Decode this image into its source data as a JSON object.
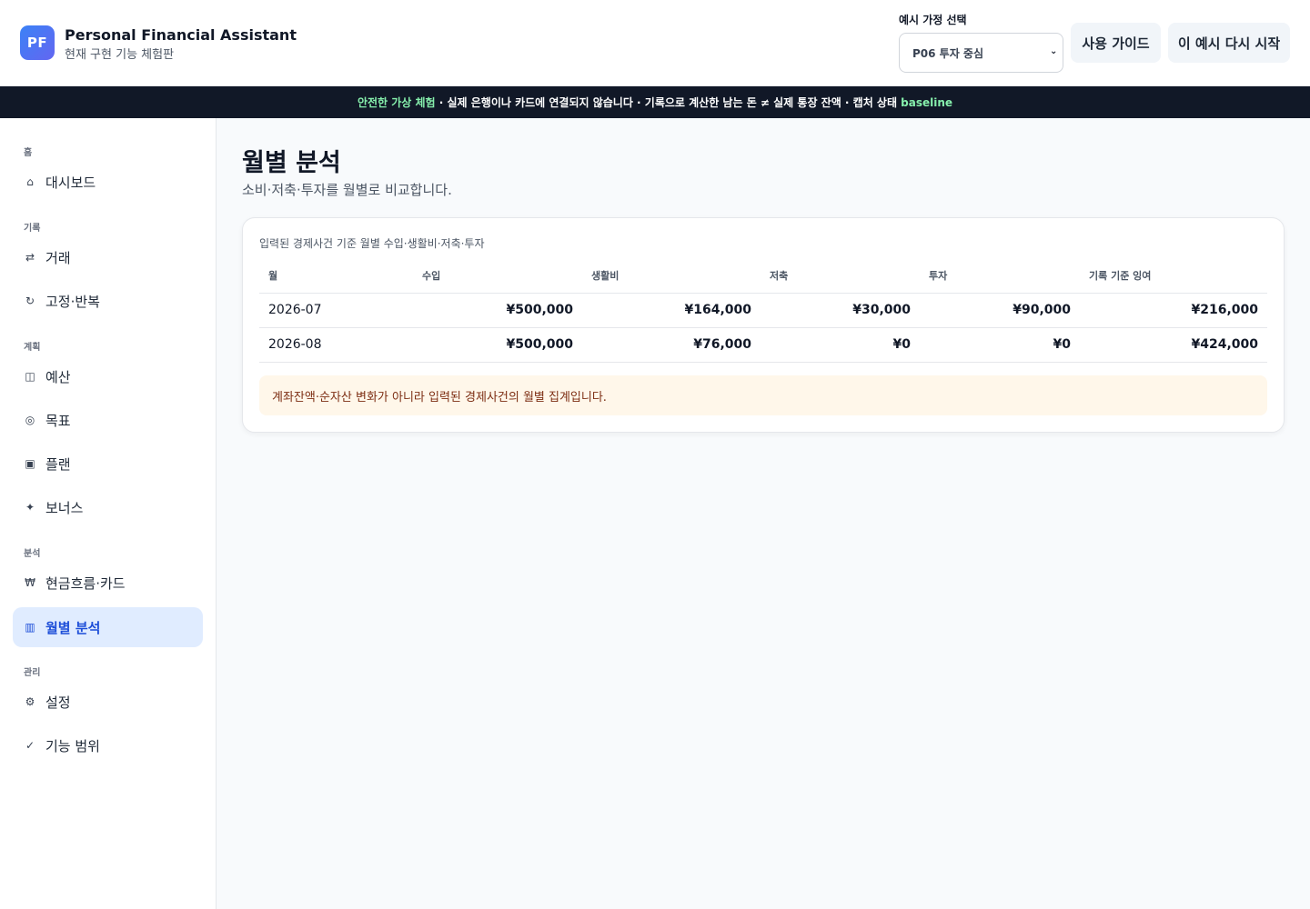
{
  "header": {
    "logo_text": "PF",
    "title": "Personal Financial Assistant",
    "subtitle": "현재 구현 기능 체험판",
    "select_label": "예시 가정 선택",
    "select_value": "P06 투자 중심",
    "guide_button": "사용 가이드",
    "restart_button": "이 예시 다시 시작"
  },
  "banner": {
    "highlight": "안전한 가상 체험",
    "text": " · 실제 은행이나 카드에 연결되지 않습니다 · 기록으로 계산한 남는 돈 ≠ 실제 통장 잔액 · 캡처 상태 ",
    "status": "baseline"
  },
  "sidebar": {
    "sections": [
      {
        "label": "홈",
        "items": [
          {
            "icon": "home-icon",
            "glyph": "⌂",
            "label": "대시보드"
          }
        ]
      },
      {
        "label": "기록",
        "items": [
          {
            "icon": "swap-icon",
            "glyph": "⇄",
            "label": "거래"
          },
          {
            "icon": "repeat-icon",
            "glyph": "↻",
            "label": "고정·반복"
          }
        ]
      },
      {
        "label": "계획",
        "items": [
          {
            "icon": "budget-icon",
            "glyph": "◫",
            "label": "예산"
          },
          {
            "icon": "target-icon",
            "glyph": "◎",
            "label": "목표"
          },
          {
            "icon": "plan-icon",
            "glyph": "▣",
            "label": "플랜"
          },
          {
            "icon": "sparkle-icon",
            "glyph": "✦",
            "label": "보너스"
          }
        ]
      },
      {
        "label": "분석",
        "items": [
          {
            "icon": "won-icon",
            "glyph": "₩",
            "label": "현금흐름·카드"
          },
          {
            "icon": "bar-chart-icon",
            "glyph": "▥",
            "label": "월별 분석",
            "active": true
          }
        ]
      },
      {
        "label": "관리",
        "items": [
          {
            "icon": "gear-icon",
            "glyph": "⚙",
            "label": "설정"
          },
          {
            "icon": "check-icon",
            "glyph": "✓",
            "label": "기능 범위"
          }
        ]
      }
    ]
  },
  "main": {
    "title": "월별 분석",
    "subtitle": "소비·저축·투자를 월별로 비교합니다.",
    "card_caption": "입력된 경제사건 기준 월별 수입·생활비·저축·투자",
    "columns": [
      "월",
      "수입",
      "생활비",
      "저축",
      "투자",
      "기록 기준 잉여"
    ],
    "rows": [
      [
        "2026-07",
        "¥500,000",
        "¥164,000",
        "¥30,000",
        "¥90,000",
        "¥216,000"
      ],
      [
        "2026-08",
        "¥500,000",
        "¥76,000",
        "¥0",
        "¥0",
        "¥424,000"
      ]
    ],
    "note": "계좌잔액·순자산 변화가 아니라 입력된 경제사건의 월별 집계입니다."
  }
}
